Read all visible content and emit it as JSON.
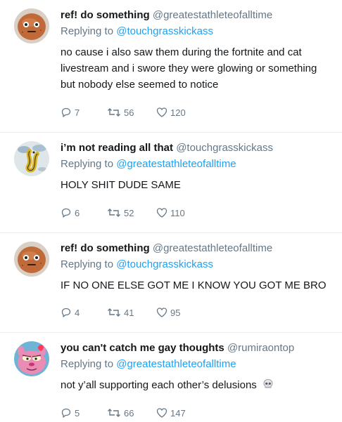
{
  "tweets": [
    {
      "display_name": "ref! do something",
      "handle": "@greatestathleteofalltime",
      "replying_prefix": "Replying to",
      "replying_to": "@touchgrasskickass",
      "text": "no cause i also saw them during the fortnite and cat livestream and i swore they were glowing or something but nobody else seemed to notice",
      "replies": "7",
      "retweets": "56",
      "likes": "120",
      "avatar": "potato-face-avatar"
    },
    {
      "display_name": "i’m not reading all that",
      "handle": "@touchgrasskickass",
      "replying_prefix": "Replying to",
      "replying_to": "@greatestathleteofalltime",
      "text": "HOLY SHIT DUDE SAME",
      "replies": "6",
      "retweets": "52",
      "likes": "110",
      "avatar": "cartoon-yellow-figure-avatar"
    },
    {
      "display_name": "ref! do something",
      "handle": "@greatestathleteofalltime",
      "replying_prefix": "Replying to",
      "replying_to": "@touchgrasskickass",
      "text": "IF NO ONE ELSE GOT ME I KNOW YOU GOT ME BRO",
      "replies": "4",
      "retweets": "41",
      "likes": "95",
      "avatar": "potato-face-avatar"
    },
    {
      "display_name": "you can't catch me gay thoughts",
      "handle": "@rumiraontop",
      "replying_prefix": "Replying to",
      "replying_to": "@greatestathleteofalltime",
      "text": "not y’all supporting each other’s delusions",
      "text_emoji": "skull-icon",
      "replies": "5",
      "retweets": "66",
      "likes": "147",
      "avatar": "pink-panther-avatar"
    }
  ],
  "colors": {
    "link": "#1da1f2",
    "muted": "#657786",
    "text": "#14171a",
    "divider": "#e6ecf0"
  }
}
